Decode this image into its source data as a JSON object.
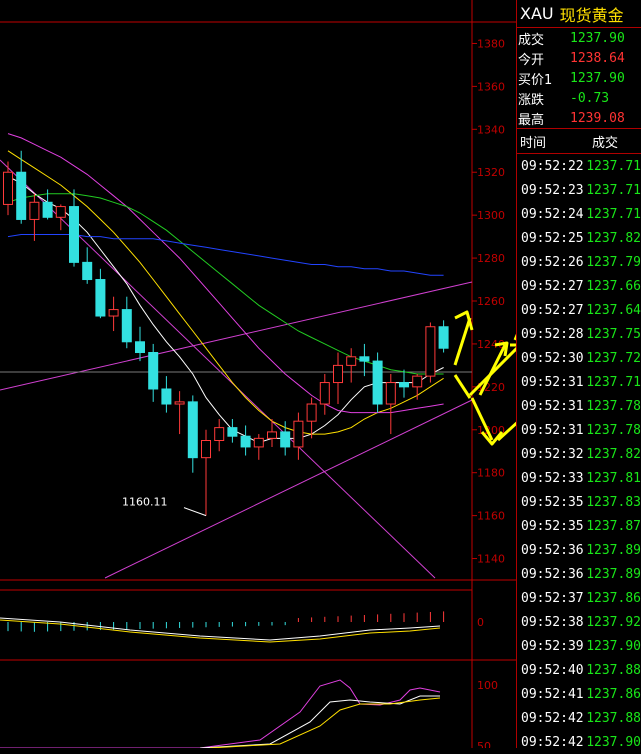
{
  "colors": {
    "up": "#ff3a3a",
    "down": "#33e0e0",
    "axis": "#c00000",
    "ma5": "#ffffff",
    "ma10": "#ffe000",
    "ma20": "#e040e0",
    "ma40": "#22cc22",
    "ma60": "#2244ff",
    "trend": "#d040d0",
    "arrow": "#ffff00",
    "green_text": "#19e619",
    "red_text": "#ff3333"
  },
  "quote": {
    "symbol": "XAU",
    "name": "现货黄金",
    "rows": [
      {
        "label": "成交",
        "value": "1237.90",
        "color": "#19e619"
      },
      {
        "label": "今开",
        "value": "1238.64",
        "color": "#ff3333"
      },
      {
        "label": "买价1",
        "value": "1237.90",
        "color": "#19e619"
      },
      {
        "label": "涨跌",
        "value": "-0.73",
        "color": "#19e619"
      },
      {
        "label": "最高",
        "value": "1239.08",
        "color": "#ff3333"
      }
    ]
  },
  "ticks": {
    "header_time": "时间",
    "header_price": "成交",
    "rows": [
      {
        "time": "09:52:22",
        "price": "1237.71"
      },
      {
        "time": "09:52:23",
        "price": "1237.71"
      },
      {
        "time": "09:52:24",
        "price": "1237.71"
      },
      {
        "time": "09:52:25",
        "price": "1237.82"
      },
      {
        "time": "09:52:26",
        "price": "1237.79"
      },
      {
        "time": "09:52:27",
        "price": "1237.66"
      },
      {
        "time": "09:52:27",
        "price": "1237.64"
      },
      {
        "time": "09:52:28",
        "price": "1237.75"
      },
      {
        "time": "09:52:30",
        "price": "1237.72"
      },
      {
        "time": "09:52:31",
        "price": "1237.71"
      },
      {
        "time": "09:52:31",
        "price": "1237.78"
      },
      {
        "time": "09:52:31",
        "price": "1237.78"
      },
      {
        "time": "09:52:32",
        "price": "1237.82"
      },
      {
        "time": "09:52:33",
        "price": "1237.81"
      },
      {
        "time": "09:52:35",
        "price": "1237.83"
      },
      {
        "time": "09:52:35",
        "price": "1237.87"
      },
      {
        "time": "09:52:36",
        "price": "1237.89"
      },
      {
        "time": "09:52:36",
        "price": "1237.89"
      },
      {
        "time": "09:52:37",
        "price": "1237.86"
      },
      {
        "time": "09:52:38",
        "price": "1237.92"
      },
      {
        "time": "09:52:39",
        "price": "1237.90"
      },
      {
        "time": "09:52:40",
        "price": "1237.88"
      },
      {
        "time": "09:52:41",
        "price": "1237.86"
      },
      {
        "time": "09:52:42",
        "price": "1237.88"
      },
      {
        "time": "09:52:42",
        "price": "1237.90"
      }
    ]
  },
  "chart_data": {
    "type": "candlestick",
    "price_axis": {
      "ticks": [
        1380,
        1360,
        1340,
        1320,
        1300,
        1280,
        1260,
        1240,
        1220,
        1200,
        1180,
        1160,
        1140
      ],
      "range": [
        1130,
        1390
      ]
    },
    "low_annotation": "1160.11",
    "candles": [
      {
        "o": 1305,
        "h": 1325,
        "l": 1300,
        "c": 1320
      },
      {
        "o": 1320,
        "h": 1330,
        "l": 1296,
        "c": 1298
      },
      {
        "o": 1298,
        "h": 1310,
        "l": 1288,
        "c": 1306
      },
      {
        "o": 1306,
        "h": 1312,
        "l": 1298,
        "c": 1299
      },
      {
        "o": 1299,
        "h": 1305,
        "l": 1293,
        "c": 1304
      },
      {
        "o": 1304,
        "h": 1312,
        "l": 1276,
        "c": 1278
      },
      {
        "o": 1278,
        "h": 1285,
        "l": 1268,
        "c": 1270
      },
      {
        "o": 1270,
        "h": 1275,
        "l": 1252,
        "c": 1253
      },
      {
        "o": 1253,
        "h": 1262,
        "l": 1246,
        "c": 1256
      },
      {
        "o": 1256,
        "h": 1262,
        "l": 1238,
        "c": 1241
      },
      {
        "o": 1241,
        "h": 1248,
        "l": 1232,
        "c": 1236
      },
      {
        "o": 1236,
        "h": 1240,
        "l": 1213,
        "c": 1219
      },
      {
        "o": 1219,
        "h": 1225,
        "l": 1208,
        "c": 1212
      },
      {
        "o": 1212,
        "h": 1218,
        "l": 1198,
        "c": 1213
      },
      {
        "o": 1213,
        "h": 1216,
        "l": 1180,
        "c": 1187
      },
      {
        "o": 1187,
        "h": 1200,
        "l": 1160,
        "c": 1195
      },
      {
        "o": 1195,
        "h": 1205,
        "l": 1190,
        "c": 1201
      },
      {
        "o": 1201,
        "h": 1205,
        "l": 1194,
        "c": 1197
      },
      {
        "o": 1197,
        "h": 1202,
        "l": 1188,
        "c": 1192
      },
      {
        "o": 1192,
        "h": 1198,
        "l": 1186,
        "c": 1196
      },
      {
        "o": 1196,
        "h": 1205,
        "l": 1192,
        "c": 1199
      },
      {
        "o": 1199,
        "h": 1204,
        "l": 1188,
        "c": 1192
      },
      {
        "o": 1192,
        "h": 1208,
        "l": 1186,
        "c": 1204
      },
      {
        "o": 1204,
        "h": 1215,
        "l": 1196,
        "c": 1212
      },
      {
        "o": 1212,
        "h": 1226,
        "l": 1207,
        "c": 1222
      },
      {
        "o": 1222,
        "h": 1236,
        "l": 1212,
        "c": 1230
      },
      {
        "o": 1230,
        "h": 1238,
        "l": 1222,
        "c": 1234
      },
      {
        "o": 1234,
        "h": 1240,
        "l": 1225,
        "c": 1232
      },
      {
        "o": 1232,
        "h": 1236,
        "l": 1208,
        "c": 1212
      },
      {
        "o": 1212,
        "h": 1226,
        "l": 1198,
        "c": 1222
      },
      {
        "o": 1222,
        "h": 1228,
        "l": 1215,
        "c": 1220
      },
      {
        "o": 1220,
        "h": 1226,
        "l": 1214,
        "c": 1225
      },
      {
        "o": 1225,
        "h": 1250,
        "l": 1222,
        "c": 1248
      },
      {
        "o": 1248,
        "h": 1251,
        "l": 1236,
        "c": 1238
      }
    ],
    "ma": [
      {
        "key": "ma5",
        "values": [
          1318,
          1315,
          1310,
          1306,
          1303,
          1298,
          1292,
          1284,
          1276,
          1268,
          1258,
          1249,
          1241,
          1234,
          1226,
          1215,
          1207,
          1200,
          1197,
          1194,
          1196,
          1196,
          1196,
          1198,
          1202,
          1207,
          1214,
          1220,
          1222,
          1222,
          1222,
          1222,
          1226,
          1229
        ]
      },
      {
        "key": "ma10",
        "values": [
          1330,
          1326,
          1322,
          1318,
          1314,
          1309,
          1304,
          1298,
          1292,
          1285,
          1278,
          1270,
          1262,
          1254,
          1246,
          1238,
          1230,
          1222,
          1215,
          1209,
          1204,
          1201,
          1199,
          1198,
          1198,
          1199,
          1201,
          1205,
          1208,
          1210,
          1213,
          1216,
          1220,
          1224
        ]
      },
      {
        "key": "ma20",
        "values": [
          1338,
          1336,
          1333,
          1330,
          1327,
          1323,
          1319,
          1314,
          1309,
          1304,
          1298,
          1292,
          1286,
          1280,
          1273,
          1266,
          1259,
          1252,
          1245,
          1238,
          1232,
          1226,
          1221,
          1216,
          1212,
          1209,
          1208,
          1208,
          1208,
          1208,
          1209,
          1210,
          1211,
          1212
        ]
      },
      {
        "key": "ma40",
        "values": [
          1306,
          1308,
          1309,
          1310,
          1310,
          1310,
          1309,
          1308,
          1306,
          1304,
          1301,
          1297,
          1293,
          1288,
          1283,
          1278,
          1273,
          1268,
          1263,
          1258,
          1254,
          1250,
          1246,
          1243,
          1240,
          1237,
          1234,
          1232,
          1230,
          1228,
          1227,
          1226,
          1226,
          1226
        ]
      },
      {
        "key": "ma60",
        "values": [
          1290,
          1291,
          1291,
          1291,
          1291,
          1291,
          1290,
          1290,
          1289,
          1289,
          1289,
          1289,
          1288,
          1287,
          1286,
          1285,
          1284,
          1283,
          1282,
          1281,
          1280,
          1279,
          1278,
          1277,
          1277,
          1276,
          1276,
          1275,
          1275,
          1274,
          1274,
          1273,
          1272,
          1272
        ]
      }
    ],
    "sub_axis": {
      "macd_tick": "0",
      "kdj_ticks": [
        "100",
        "50"
      ]
    }
  }
}
